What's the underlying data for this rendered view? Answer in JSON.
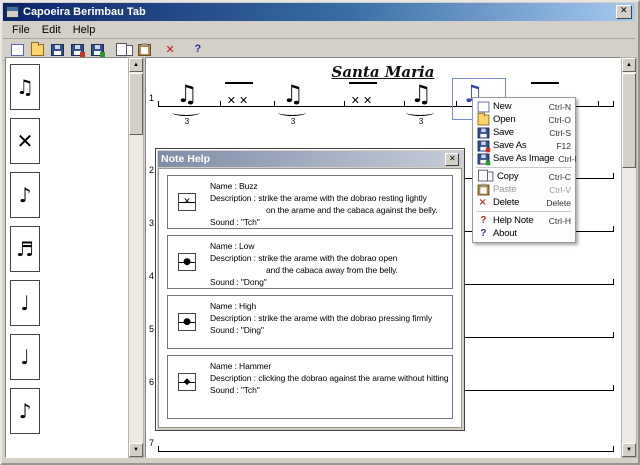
{
  "window": {
    "title": "Capoeira Berimbau Tab",
    "menu": [
      "File",
      "Edit",
      "Help"
    ]
  },
  "toolbar": {
    "buttons": [
      {
        "icon": "new-page-icon"
      },
      {
        "icon": "open-folder-icon"
      },
      {
        "icon": "save-disk-icon"
      },
      {
        "icon": "save-as-icon"
      },
      {
        "icon": "save-as-image-icon"
      },
      {
        "icon": "copy-icon"
      },
      {
        "icon": "paste-icon"
      },
      {
        "icon": "delete-icon"
      },
      {
        "icon": "help-icon"
      }
    ]
  },
  "palette": {
    "items": [
      {
        "name": "beamed-note-pair",
        "glyph": "♫"
      },
      {
        "name": "x-note",
        "glyph": "✕"
      },
      {
        "name": "single-eighth-note",
        "glyph": "♪"
      },
      {
        "name": "beamed-sixteenth-group",
        "glyph": "♬"
      },
      {
        "name": "quarter-note",
        "glyph": "♩"
      },
      {
        "name": "low-note",
        "glyph": "♩"
      },
      {
        "name": "eighth-note",
        "glyph": "♪"
      }
    ]
  },
  "canvas": {
    "title": "Santa Maria",
    "line_numbers": [
      "1",
      "2",
      "3",
      "4",
      "5",
      "6",
      "7"
    ],
    "groups": [
      {
        "glyph": "♫",
        "triplet": "3"
      },
      {
        "glyph": "✕✕",
        "triplet": ""
      },
      {
        "glyph": "♫",
        "triplet": "3"
      },
      {
        "glyph": "✕✕",
        "triplet": ""
      },
      {
        "glyph": "♫",
        "triplet": "3"
      },
      {
        "glyph": "♫",
        "triplet": ""
      },
      {
        "glyph": "✕",
        "triplet": ""
      }
    ]
  },
  "note_help": {
    "title": "Note Help",
    "entries": [
      {
        "glyph": "✕",
        "name": "Name : Buzz",
        "desc1": "Description : strike the arame with the dobrao resting lightly",
        "desc2": "on the arame and the cabaca against the belly.",
        "sound": "Sound : \"Tch\""
      },
      {
        "glyph": "●",
        "name": "Name : Low",
        "desc1": "Description : strike the arame with the dobrao open",
        "desc2": "and the cabaca away from the belly.",
        "sound": "Sound : \"Dong\""
      },
      {
        "glyph": "●",
        "name": "Name : High",
        "desc1": "Description : strike the arame with the dobrao pressing firmly",
        "desc2": "",
        "sound": "Sound : \"Ding\""
      },
      {
        "glyph": "◆",
        "name": "Name : Hammer",
        "desc1": "Description : clicking the dobrao against the arame without hitting",
        "desc2": "",
        "sound": "Sound : \"Tch\""
      }
    ]
  },
  "context_menu": {
    "items": [
      {
        "label": "New",
        "shortcut": "Ctrl-N",
        "icon": "new-page-icon",
        "enabled": true
      },
      {
        "label": "Open",
        "shortcut": "Ctrl-O",
        "icon": "open-folder-icon",
        "enabled": true
      },
      {
        "label": "Save",
        "shortcut": "Ctrl-S",
        "icon": "save-disk-icon",
        "enabled": true
      },
      {
        "label": "Save As",
        "shortcut": "F12",
        "icon": "save-as-icon",
        "enabled": true
      },
      {
        "label": "Save As Image",
        "shortcut": "Ctrl-I",
        "icon": "save-as-image-icon",
        "enabled": true
      },
      {
        "label": "Copy",
        "shortcut": "Ctrl-C",
        "icon": "copy-icon",
        "enabled": true
      },
      {
        "label": "Paste",
        "shortcut": "Ctrl-V",
        "icon": "paste-icon",
        "enabled": false
      },
      {
        "label": "Delete",
        "shortcut": "Delete",
        "icon": "delete-icon",
        "enabled": true
      },
      {
        "label": "Help Note",
        "shortcut": "Ctrl-H",
        "icon": "help-note-icon",
        "enabled": true
      },
      {
        "label": "About",
        "shortcut": "",
        "icon": "about-icon",
        "enabled": true
      }
    ]
  }
}
